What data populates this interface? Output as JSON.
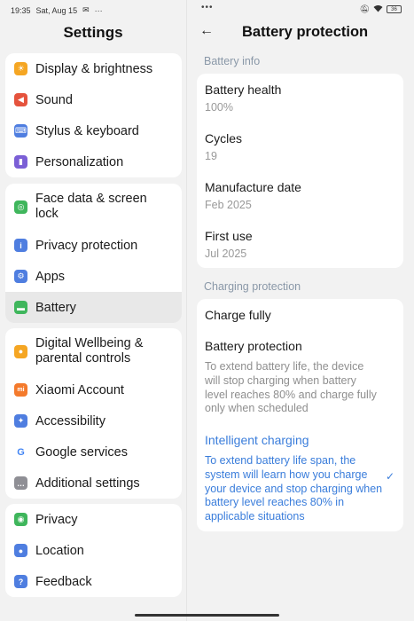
{
  "status": {
    "time": "19:35",
    "date": "Sat, Aug 15",
    "battery": "36"
  },
  "left": {
    "title": "Settings",
    "groups": [
      [
        {
          "label": "Display & brightness",
          "icon": "sun-icon",
          "color": "#f5a623"
        },
        {
          "label": "Sound",
          "icon": "speaker-icon",
          "color": "#e5533d"
        },
        {
          "label": "Stylus & keyboard",
          "icon": "keyboard-icon",
          "color": "#4f7ee0"
        },
        {
          "label": "Personalization",
          "icon": "brush-icon",
          "color": "#7b5fd6"
        }
      ],
      [
        {
          "label": "Face data & screen lock",
          "icon": "fingerprint-icon",
          "color": "#3fb65c"
        },
        {
          "label": "Privacy protection",
          "icon": "info-icon",
          "color": "#4f7ee0"
        },
        {
          "label": "Apps",
          "icon": "gear-icon",
          "color": "#4f7ee0"
        },
        {
          "label": "Battery",
          "icon": "battery-icon",
          "color": "#3fb65c"
        }
      ],
      [
        {
          "label": "Digital Wellbeing & parental controls",
          "icon": "person-icon",
          "color": "#f5a623"
        },
        {
          "label": "Xiaomi Account",
          "icon": "mi-icon",
          "color": "#f47a2c"
        },
        {
          "label": "Accessibility",
          "icon": "accessibility-icon",
          "color": "#4f7ee0"
        },
        {
          "label": "Google services",
          "icon": "google-icon",
          "color": "#ffffff"
        },
        {
          "label": "Additional settings",
          "icon": "more-icon",
          "color": "#8f8f95"
        }
      ],
      [
        {
          "label": "Privacy",
          "icon": "eye-icon",
          "color": "#3fb65c"
        },
        {
          "label": "Location",
          "icon": "location-pin-icon",
          "color": "#4f7ee0"
        },
        {
          "label": "Feedback",
          "icon": "help-icon",
          "color": "#4f7ee0"
        }
      ]
    ]
  },
  "right": {
    "title": "Battery protection",
    "info_label": "Battery info",
    "health_title": "Battery health",
    "health_value": "100%",
    "cycles_title": "Cycles",
    "cycles_value": "19",
    "manufacture_title": "Manufacture date",
    "manufacture_value": "Feb 2025",
    "first_use_title": "First use",
    "first_use_value": "Jul 2025",
    "charging_label": "Charging protection",
    "charge_fully": "Charge fully",
    "protection_title": "Battery protection",
    "protection_desc": "To extend battery life, the device will stop charging when battery level reaches 80% and charge fully only when scheduled",
    "intelligent_title": "Intelligent charging",
    "intelligent_desc": "To extend battery life span, the system will learn how you charge your device and stop charging when battery level reaches 80% in applicable situations"
  },
  "colors": {
    "accent": "#3a7ddb",
    "section_label": "#8a98a8"
  }
}
